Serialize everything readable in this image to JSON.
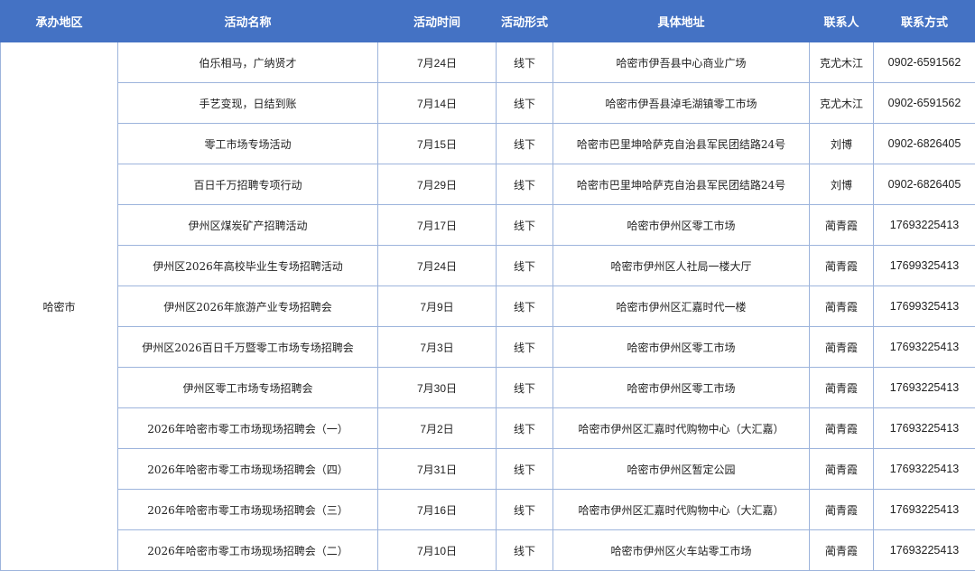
{
  "table": {
    "headers": [
      "承办地区",
      "活动名称",
      "活动时间",
      "活动形式",
      "具体地址",
      "联系人",
      "联系方式"
    ],
    "region": "哈密市",
    "rows": [
      {
        "name": "伯乐相马，广纳贤才",
        "time": "7月24日",
        "form": "线下",
        "address": "哈密市伊吾县中心商业广场",
        "contact": "克尤木江",
        "phone": "0902-6591562"
      },
      {
        "name": "手艺变现，日结到账",
        "time": "7月14日",
        "form": "线下",
        "address": "哈密市伊吾县淖毛湖镇零工市场",
        "contact": "克尤木江",
        "phone": "0902-6591562"
      },
      {
        "name": "零工市场专场活动",
        "time": "7月15日",
        "form": "线下",
        "address": "哈密市巴里坤哈萨克自治县军民团结路24号",
        "contact": "刘博",
        "phone": "0902-6826405"
      },
      {
        "name": "百日千万招聘专项行动",
        "time": "7月29日",
        "form": "线下",
        "address": "哈密市巴里坤哈萨克自治县军民团结路24号",
        "contact": "刘博",
        "phone": "0902-6826405"
      },
      {
        "name": "伊州区煤炭矿产招聘活动",
        "time": "7月17日",
        "form": "线下",
        "address": "哈密市伊州区零工市场",
        "contact": "蔺青霞",
        "phone": "17693225413"
      },
      {
        "name": "伊州区2026年高校毕业生专场招聘活动",
        "time": "7月24日",
        "form": "线下",
        "address": "哈密市伊州区人社局一楼大厅",
        "contact": "蔺青霞",
        "phone": "17699325413"
      },
      {
        "name": "伊州区2026年旅游产业专场招聘会",
        "time": "7月9日",
        "form": "线下",
        "address": "哈密市伊州区汇嘉时代一楼",
        "contact": "蔺青霞",
        "phone": "17699325413"
      },
      {
        "name": "伊州区2026百日千万暨零工市场专场招聘会",
        "time": "7月3日",
        "form": "线下",
        "address": "哈密市伊州区零工市场",
        "contact": "蔺青霞",
        "phone": "17693225413"
      },
      {
        "name": "伊州区零工市场专场招聘会",
        "time": "7月30日",
        "form": "线下",
        "address": "哈密市伊州区零工市场",
        "contact": "蔺青霞",
        "phone": "17693225413"
      },
      {
        "name": "2026年哈密市零工市场现场招聘会（一）",
        "time": "7月2日",
        "form": "线下",
        "address": "哈密市伊州区汇嘉时代购物中心（大汇嘉）",
        "contact": "蔺青霞",
        "phone": "17693225413"
      },
      {
        "name": "2026年哈密市零工市场现场招聘会（四）",
        "time": "7月31日",
        "form": "线下",
        "address": "哈密市伊州区暂定公园",
        "contact": "蔺青霞",
        "phone": "17693225413"
      },
      {
        "name": "2026年哈密市零工市场现场招聘会（三）",
        "time": "7月16日",
        "form": "线下",
        "address": "哈密市伊州区汇嘉时代购物中心（大汇嘉）",
        "contact": "蔺青霞",
        "phone": "17693225413"
      },
      {
        "name": "2026年哈密市零工市场现场招聘会（二）",
        "time": "7月10日",
        "form": "线下",
        "address": "哈密市伊州区火车站零工市场",
        "contact": "蔺青霞",
        "phone": "17693225413"
      }
    ]
  }
}
